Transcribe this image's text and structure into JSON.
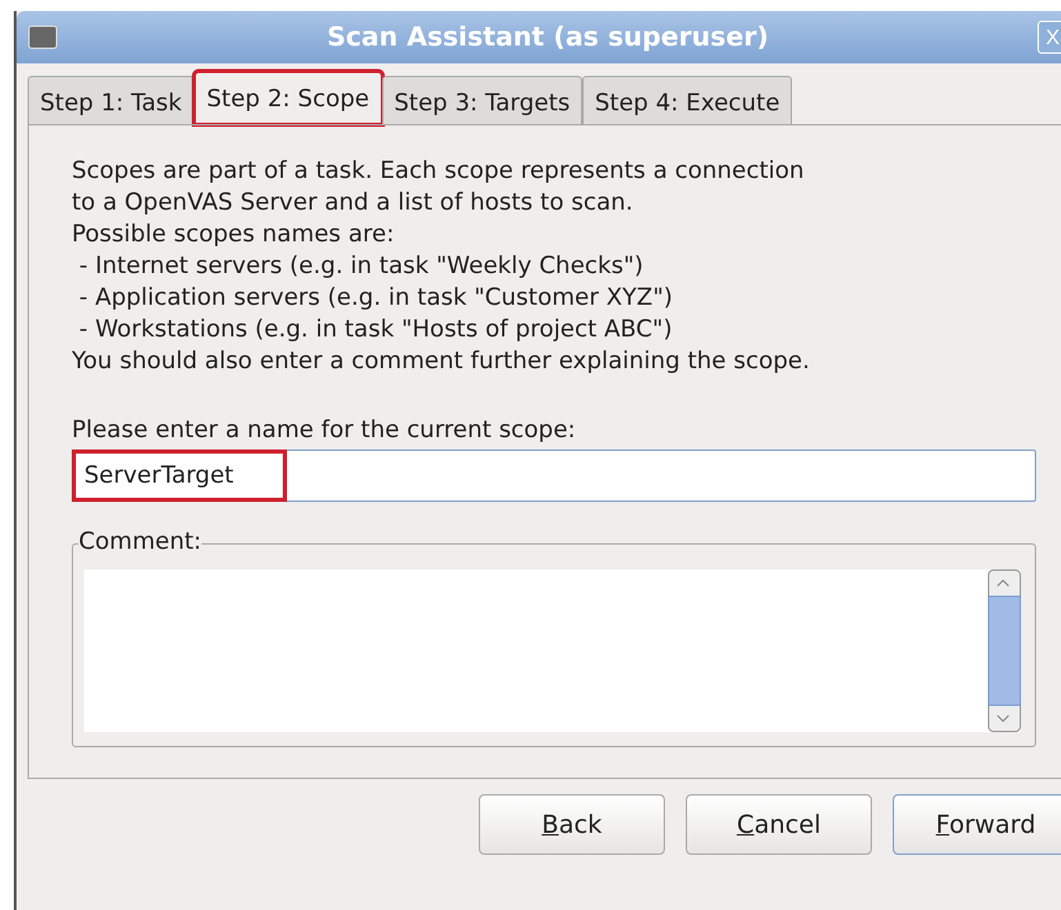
{
  "window": {
    "title": "Scan Assistant (as superuser)",
    "close": "X"
  },
  "tabs": [
    {
      "label": "Step 1: Task",
      "selected": false,
      "highlighted": false
    },
    {
      "label": "Step 2: Scope",
      "selected": true,
      "highlighted": true
    },
    {
      "label": "Step 3: Targets",
      "selected": false,
      "highlighted": false
    },
    {
      "label": "Step 4: Execute",
      "selected": false,
      "highlighted": false
    }
  ],
  "description": [
    "Scopes are part of a task. Each scope represents a connection",
    "to a OpenVAS Server and a list of hosts to scan.",
    "Possible scopes names are:",
    " - Internet servers (e.g. in task \"Weekly Checks\")",
    " - Application servers (e.g. in task \"Customer XYZ\")",
    " - Workstations (e.g. in task \"Hosts of project ABC\")",
    "You should also enter a comment further explaining the scope."
  ],
  "name_field": {
    "label": "Please enter a name for the current scope:",
    "value": "ServerTarget",
    "highlighted": true
  },
  "comment": {
    "label": "Comment:"
  },
  "buttons": [
    {
      "mnemonic": "B",
      "rest": "ack",
      "default": false
    },
    {
      "mnemonic": "C",
      "rest": "ancel",
      "default": false
    },
    {
      "mnemonic": "F",
      "rest": "orward",
      "default": true
    }
  ]
}
